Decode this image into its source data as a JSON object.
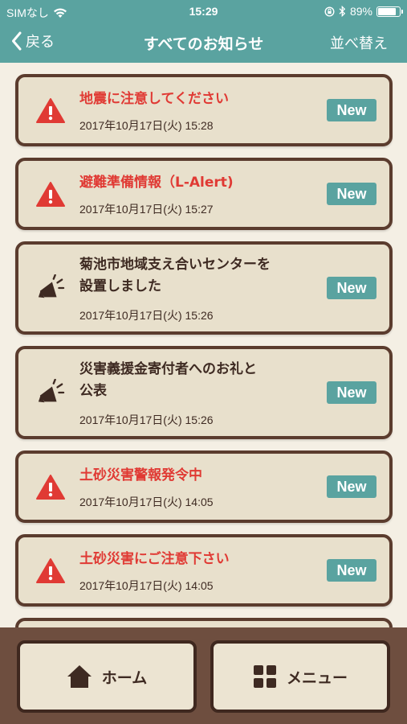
{
  "status": {
    "carrier": "SIMなし",
    "time": "15:29",
    "battery": "89%",
    "battery_level": 0.89
  },
  "nav": {
    "back": "戻る",
    "title": "すべてのお知らせ",
    "sort": "並べ替え"
  },
  "notices": [
    {
      "type": "alert",
      "lines": [
        "地震に注意してください"
      ],
      "date": "2017年10月17日(火) 15:28",
      "badge": "New"
    },
    {
      "type": "alert",
      "lines": [
        "避難準備情報（L-Alert)"
      ],
      "date": "2017年10月17日(火) 15:27",
      "badge": "New"
    },
    {
      "type": "info",
      "lines": [
        "菊池市地域支え合いセンターを",
        "設置しました"
      ],
      "date": "2017年10月17日(火) 15:26",
      "badge": "New"
    },
    {
      "type": "info",
      "lines": [
        "災害義援金寄付者へのお礼と",
        "公表"
      ],
      "date": "2017年10月17日(火) 15:26",
      "badge": "New"
    },
    {
      "type": "alert",
      "lines": [
        "土砂災害警報発令中"
      ],
      "date": "2017年10月17日(火) 14:05",
      "badge": "New"
    },
    {
      "type": "alert",
      "lines": [
        "土砂災害にご注意下さい"
      ],
      "date": "2017年10月17日(火) 14:05",
      "badge": "New"
    }
  ],
  "bottom": {
    "home": "ホーム",
    "menu": "メニュー"
  },
  "colors": {
    "accent": "#5aa3a0",
    "alert": "#e03a34",
    "brown": "#5b3c2e",
    "card": "#e8e0cc"
  }
}
